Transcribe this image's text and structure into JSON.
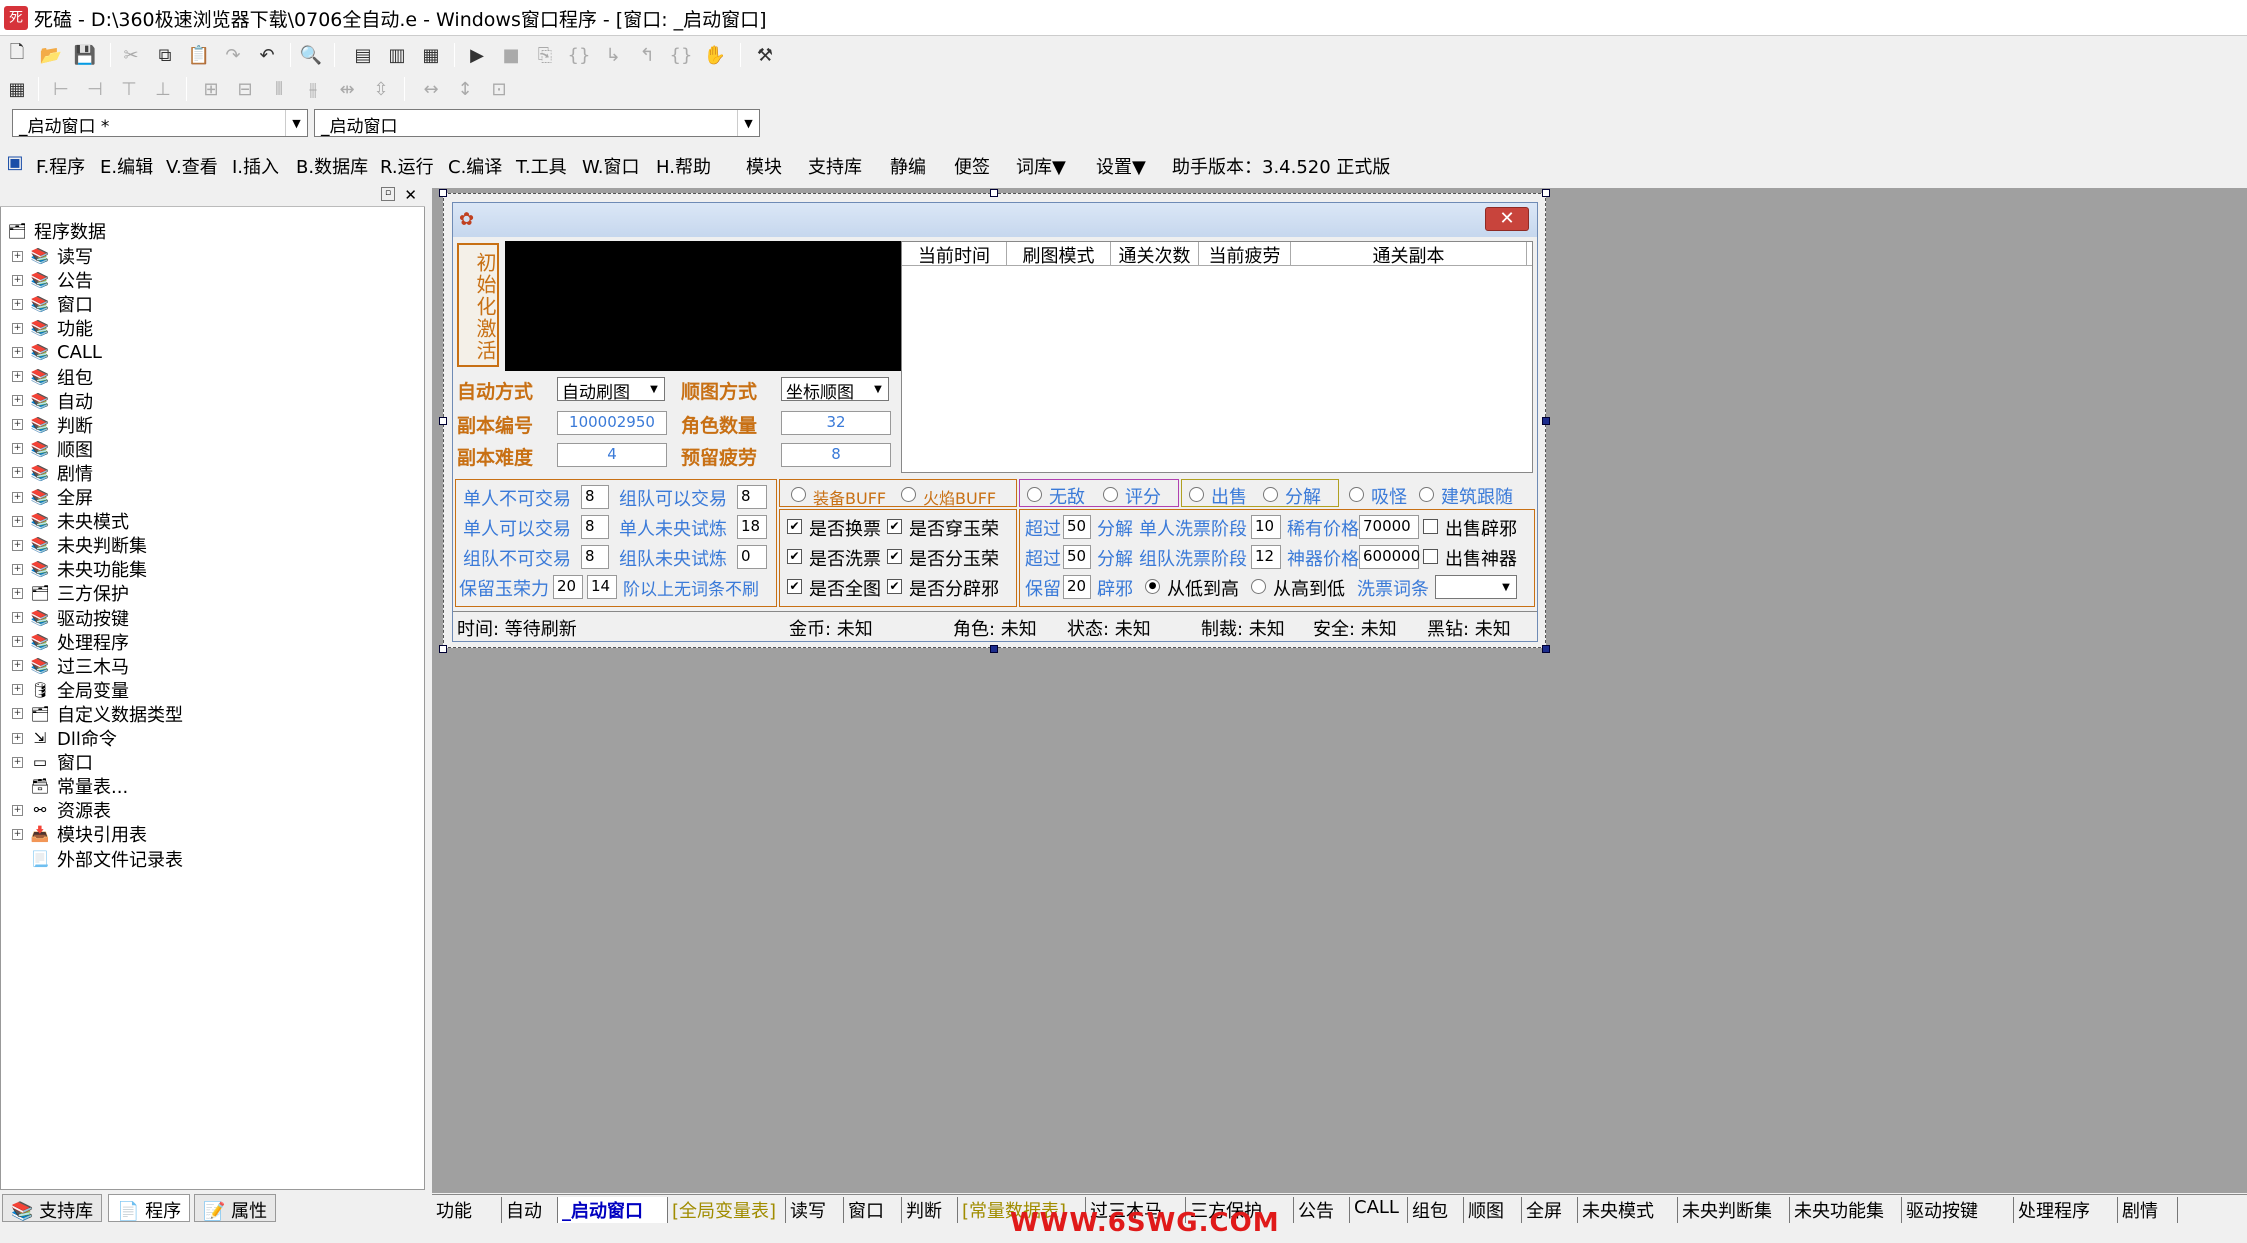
{
  "titlebar": {
    "title": "死磕 - D:\\360极速浏览器下载\\0706全自动.e - Windows窗口程序 - [窗口: _启动窗口]"
  },
  "combos": {
    "left": "_启动窗口 *",
    "right": "_启动窗口"
  },
  "menu": [
    "F.程序",
    "E.编辑",
    "V.查看",
    "I.插入",
    "B.数据库",
    "R.运行",
    "C.编译",
    "T.工具",
    "W.窗口",
    "H.帮助",
    "模块",
    "支持库",
    "静编",
    "便签",
    "词库▼",
    "设置▼",
    "助手版本：3.4.520 正式版"
  ],
  "tree": {
    "root": "程序数据",
    "items": [
      "读写",
      "公告",
      "窗口",
      "功能",
      "CALL",
      "组包",
      "自动",
      "判断",
      "顺图",
      "剧情",
      "全屏",
      "未央模式",
      "未央判断集",
      "未央功能集",
      "三方保护",
      "驱动按键",
      "处理程序",
      "过三木马",
      "全局变量",
      "自定义数据类型",
      "Dll命令",
      "窗口",
      "常量表...",
      "资源表",
      "模块引用表",
      "外部文件记录表"
    ]
  },
  "sidetabs": [
    "支持库",
    "程序",
    "属性"
  ],
  "form": {
    "init_button": "初始化激活",
    "labels": {
      "auto_mode": "自动方式",
      "seq_mode": "顺图方式",
      "dungeon_no": "副本编号",
      "role_count": "角色数量",
      "difficulty": "副本难度",
      "reserve_fatigue": "预留疲劳"
    },
    "values": {
      "auto_mode": "自动刷图",
      "seq_mode": "坐标顺图",
      "dungeon_no": "100002950",
      "role_count": "32",
      "difficulty": "4",
      "reserve_fatigue": "8"
    },
    "list_headers": [
      "当前时间",
      "刷图模式",
      "通关次数",
      "当前疲劳",
      "通关副本"
    ],
    "trade": [
      [
        "单人不可交易",
        "8",
        "组队可以交易",
        "8"
      ],
      [
        "单人可以交易",
        "8",
        "单人未央试炼",
        "18"
      ],
      [
        "组队不可交易",
        "8",
        "组队未央试炼",
        "0"
      ]
    ],
    "keep_jade": {
      "label": "保留玉荣力",
      "v1": "20",
      "v2": "14",
      "tail": "阶以上无词条不刷"
    },
    "radios": [
      "装备BUFF",
      "火焰BUFF",
      "无敌",
      "评分",
      "出售",
      "分解",
      "吸怪",
      "建筑跟随"
    ],
    "checks": [
      [
        "是否换票",
        "是否穿玉荣"
      ],
      [
        "是否洗票",
        "是否分玉荣"
      ],
      [
        "是否全图",
        "是否分辟邪"
      ]
    ],
    "wash": {
      "over1": "超过",
      "v1": "50",
      "fen1": "分解",
      "single": "单人洗票阶段",
      "s1": "10",
      "rare": "稀有价格",
      "rare_v": "70000",
      "sell_bx": "出售辟邪",
      "over2": "超过",
      "v2": "50",
      "fen2": "分解",
      "team": "组队洗票阶段",
      "s2": "12",
      "art": "神器价格",
      "art_v": "600000",
      "sell_sq": "出售神器",
      "keep": "保留",
      "k": "20",
      "bixie": "辟邪",
      "low": "从低到高",
      "high": "从高到低",
      "wash_words": "洗票词条"
    },
    "status": [
      "时间: 等待刷新",
      "金币: 未知",
      "角色: 未知",
      "状态: 未知",
      "制裁: 未知",
      "安全: 未知",
      "黑钻: 未知"
    ]
  },
  "bottom_tabs": [
    "功能",
    "自动",
    "_启动窗口",
    "[全局变量表]",
    "读写",
    "窗口",
    "判断",
    "[常量数据表]",
    "过三木马",
    "三方保护",
    "公告",
    "CALL",
    "组包",
    "顺图",
    "全屏",
    "未央模式",
    "未央判断集",
    "未央功能集",
    "驱动按键",
    "处理程序",
    "剧情"
  ],
  "watermark": "WWW.6SWG.COM"
}
